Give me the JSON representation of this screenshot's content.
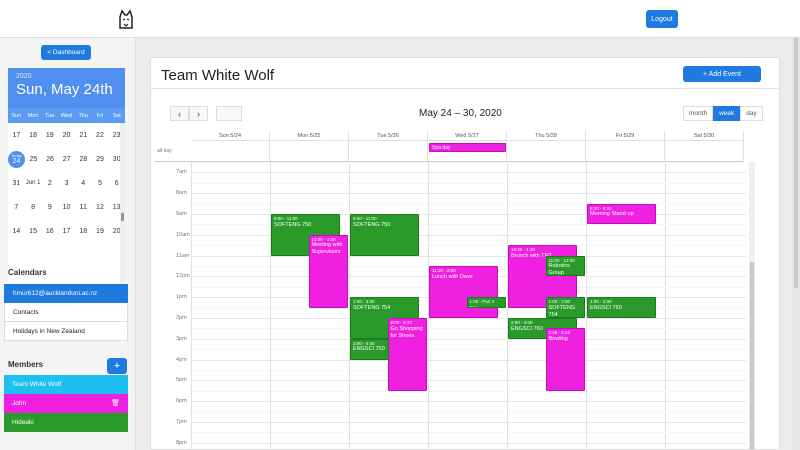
{
  "header": {
    "logout_label": "Logout"
  },
  "sidebar": {
    "dashboard_label": "< Dashboard",
    "mini_calendar": {
      "year": "2020",
      "date_label": "Sun, May 24th",
      "dow": [
        "Sun",
        "Mon",
        "Tue",
        "Wed",
        "Thu",
        "Fri",
        "Sat"
      ],
      "rows": [
        [
          "17",
          "18",
          "19",
          "20",
          "21",
          "22",
          "23"
        ],
        [
          "Today 24",
          "25",
          "26",
          "27",
          "28",
          "29",
          "30"
        ],
        [
          "31",
          "Jun 1",
          "2",
          "3",
          "4",
          "5",
          "6"
        ],
        [
          "7",
          "8",
          "9",
          "10",
          "11",
          "12",
          "13"
        ],
        [
          "14",
          "15",
          "16",
          "17",
          "18",
          "19",
          "20"
        ]
      ]
    },
    "calendars_title": "Calendars",
    "calendars": [
      "hmur612@aucklanduni.ac.nz",
      "Contacts",
      "Holidays in New Zealand"
    ],
    "members_title": "Members",
    "add_member_label": "+",
    "members": [
      {
        "name": "Team White Wolf",
        "color": "#1ec0f0"
      },
      {
        "name": "John",
        "color": "#f020e0"
      },
      {
        "name": "Hideaki",
        "color": "#2a9b2a"
      }
    ]
  },
  "main": {
    "title": "Team White Wolf",
    "add_event_label": "+ Add Event",
    "prev_label": "‹",
    "next_label": "›",
    "range_title": "May 24 – 30, 2020",
    "views": [
      "month",
      "week",
      "day"
    ],
    "active_view": "week",
    "days": [
      "Sun 5/24",
      "Mon 5/25",
      "Tue 5/26",
      "Wed 5/27",
      "Thu 5/28",
      "Fri 5/29",
      "Sat 5/30"
    ],
    "all_day_label": "all-day",
    "hours": [
      "7am",
      "8am",
      "9am",
      "10am",
      "11am",
      "12pm",
      "1pm",
      "2pm",
      "3pm",
      "4pm",
      "5pm",
      "6pm",
      "7pm",
      "8pm"
    ],
    "all_day_events": [
      {
        "day": 3,
        "title": "Spa day",
        "color": "pink"
      }
    ],
    "events": [
      {
        "day": 1,
        "start": 9.0,
        "end": 11.0,
        "col": 0,
        "cols": 1,
        "time": "9:00 - 11:00",
        "title": "SOFTENG 750",
        "color": "green"
      },
      {
        "day": 1,
        "start": 10.0,
        "end": 13.5,
        "col": 1,
        "cols": 2,
        "time": "10:00 - 1:30",
        "title": "Meeting with Supervisors",
        "color": "pink"
      },
      {
        "day": 2,
        "start": 9.0,
        "end": 11.0,
        "col": 0,
        "cols": 1,
        "time": "9:00 - 11:00",
        "title": "SOFTENG 750",
        "color": "green"
      },
      {
        "day": 2,
        "start": 13.0,
        "end": 15.0,
        "col": 0,
        "cols": 1,
        "time": "1:00 - 3:00",
        "title": "SOFTENG 754",
        "color": "green"
      },
      {
        "day": 2,
        "start": 14.0,
        "end": 17.5,
        "col": 1,
        "cols": 2,
        "time": "2:00 - 5:45",
        "title": "Go Shopping for Shoes",
        "color": "pink"
      },
      {
        "day": 2,
        "start": 15.0,
        "end": 16.0,
        "col": 0,
        "cols": 2,
        "time": "3:00 - 4:00",
        "title": "ENGSCI 760",
        "color": "green"
      },
      {
        "day": 3,
        "start": 11.5,
        "end": 14.0,
        "col": 0,
        "cols": 1,
        "time": "11:30 - 2:00",
        "title": "Lunch with Dave",
        "color": "pink"
      },
      {
        "day": 3,
        "start": 13.0,
        "end": 13.5,
        "col": 1,
        "cols": 2,
        "time": "1:00 - Part 4 Proj",
        "title": "",
        "color": "green"
      },
      {
        "day": 4,
        "start": 10.5,
        "end": 13.5,
        "col": 0,
        "cols": 1,
        "time": "10:30 - 1:30",
        "title": "Brunch with TNT",
        "color": "pink"
      },
      {
        "day": 4,
        "start": 11.0,
        "end": 12.0,
        "col": 1,
        "cols": 2,
        "time": "11:00 - 12:00",
        "title": "Robotics Group",
        "color": "green"
      },
      {
        "day": 4,
        "start": 13.0,
        "end": 14.0,
        "col": 1,
        "cols": 2,
        "time": "1:00 - 2:00",
        "title": "SOFTENG 754",
        "color": "green"
      },
      {
        "day": 4,
        "start": 14.0,
        "end": 15.0,
        "col": 0,
        "cols": 1,
        "time": "2:00 - 3:00",
        "title": "ENGSCI 760",
        "color": "green"
      },
      {
        "day": 4,
        "start": 14.5,
        "end": 17.5,
        "col": 1,
        "cols": 2,
        "time": "2:45 - 5:45",
        "title": "Bowling",
        "color": "pink"
      },
      {
        "day": 5,
        "start": 8.5,
        "end": 9.5,
        "col": 0,
        "cols": 1,
        "time": "8:30 - 9:30",
        "title": "Morning Stand-up",
        "color": "pink"
      },
      {
        "day": 5,
        "start": 13.0,
        "end": 14.0,
        "col": 0,
        "cols": 1,
        "time": "1:00 - 3:00",
        "title": "ENGSCI 760",
        "color": "green"
      }
    ]
  }
}
